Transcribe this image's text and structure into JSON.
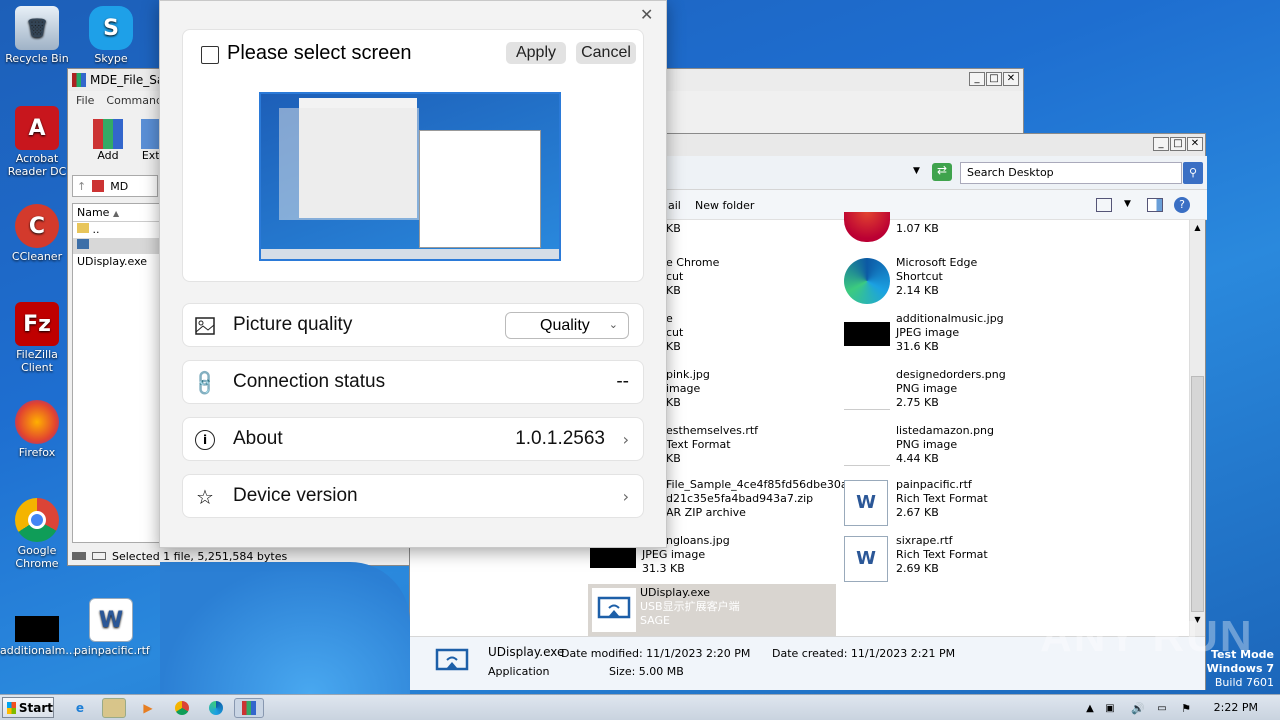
{
  "desktop": {
    "icons": [
      {
        "label": "Recycle Bin"
      },
      {
        "label": "Skype"
      },
      {
        "label": "Acrobat Reader DC"
      },
      {
        "label": "CCleaner"
      },
      {
        "label": "FileZilla Client"
      },
      {
        "label": "Firefox"
      },
      {
        "label": "Google Chrome"
      },
      {
        "label": "additionalm..."
      },
      {
        "label": "painpacific.rtf"
      }
    ]
  },
  "winrar": {
    "title": "MDE_File_Sa",
    "menu": [
      "File",
      "Commands"
    ],
    "tools": [
      "Add",
      "Extr"
    ],
    "path": "MD",
    "column_name": "Name",
    "rows": [
      "..",
      "UDisplay.exe"
    ],
    "status": "Selected 1 file, 5,251,584 bytes"
  },
  "explorer": {
    "search_placeholder": "Search Desktop",
    "toolbar": {
      "mail": "ail",
      "new_folder": "New folder"
    },
    "left_files": [
      {
        "line1": "",
        "line2": "",
        "line3": "KB"
      },
      {
        "line1": "e Chrome",
        "line2": "cut",
        "line3": "KB"
      },
      {
        "line1": "e",
        "line2": "cut",
        "line3": "KB"
      },
      {
        "line1": "pink.jpg",
        "line2": "image",
        "line3": "KB"
      },
      {
        "line1": "esthemselves.rtf",
        "line2": "Text Format",
        "line3": "KB"
      },
      {
        "line1": "File_Sample_4ce4f85fd56dbe30a",
        "line2": "d21c35e5fa4bad943a7.zip",
        "line3": "AR ZIP archive"
      },
      {
        "line1": "ngloans.jpg",
        "line2": "JPEG image",
        "line3": "31.3 KB"
      }
    ],
    "right_files": [
      {
        "name": "",
        "type": "",
        "size": "1.07 KB"
      },
      {
        "name": "Microsoft Edge",
        "type": "Shortcut",
        "size": "2.14 KB"
      },
      {
        "name": "additionalmusic.jpg",
        "type": "JPEG image",
        "size": "31.6 KB"
      },
      {
        "name": "designedorders.png",
        "type": "PNG image",
        "size": "2.75 KB"
      },
      {
        "name": "listedamazon.png",
        "type": "PNG image",
        "size": "4.44 KB"
      },
      {
        "name": "painpacific.rtf",
        "type": "Rich Text Format",
        "size": "2.67 KB"
      },
      {
        "name": "sixrape.rtf",
        "type": "Rich Text Format",
        "size": "2.69 KB"
      }
    ],
    "selected": {
      "name": "UDisplay.exe",
      "desc": "USB显示扩展客户端",
      "company": "SAGE"
    },
    "details": {
      "name": "UDisplay.exe",
      "type": "Application",
      "modified": "Date modified: 11/1/2023 2:20 PM",
      "size": "Size: 5.00 MB",
      "created": "Date created: 11/1/2023 2:21 PM"
    }
  },
  "dialog": {
    "title": "Please select screen",
    "apply": "Apply",
    "cancel": "Cancel",
    "rows": {
      "picture_quality": "Picture quality",
      "quality_select": "Quality",
      "connection_status": "Connection status",
      "connection_value": "--",
      "about": "About",
      "version": "1.0.1.2563",
      "device_version": "Device version"
    }
  },
  "taskbar": {
    "start": "Start",
    "time": "2:22 PM"
  },
  "watermark": {
    "brand": "ANY RUN",
    "line1": "Test Mode",
    "line2": "Windows 7",
    "line3": "Build 7601"
  },
  "colors": {
    "accent": "#1e6ed0",
    "selection": "#d9d5d0"
  }
}
